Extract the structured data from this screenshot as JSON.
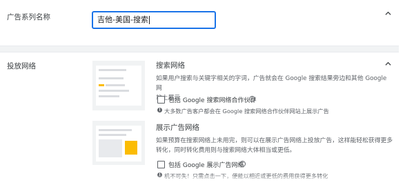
{
  "campaign_name": {
    "label": "广告系列名称",
    "value": "吉他-美国-搜索",
    "expand_icon": "chevron-up-icon"
  },
  "networks": {
    "label": "投放网络",
    "expand_icon": "chevron-up-icon",
    "search": {
      "title": "搜索网络",
      "description_line1": "如果用户搜索与关键字相关的字词，广告就会在 Google 搜索结果旁边和其他 Google 网",
      "description_line2": "站上展示",
      "checkbox_label": "包括 Google 搜索网络合作伙伴",
      "checked": false,
      "note": "大多数广告客户都会在 Google 搜索网络合作伙伴网站上展示广告"
    },
    "display": {
      "title": "展示广告网络",
      "description_line1": "如果预算在搜索网络上未用完，则可以在展示广告网络上投放广告，这样能轻松获得更多",
      "description_line2": "转化，同时转化费用则与搜索网络大体相当或更低。",
      "checkbox_label": "包括 Google 展示广告网络",
      "checked": false,
      "note": "机不可失！只需点击一下，便能以相近或更低的费用获得更多转化"
    }
  },
  "colors": {
    "accent": "#1a73e8",
    "highlight": "#fbbc04",
    "text": "#3c4043",
    "muted": "#5f6368"
  }
}
